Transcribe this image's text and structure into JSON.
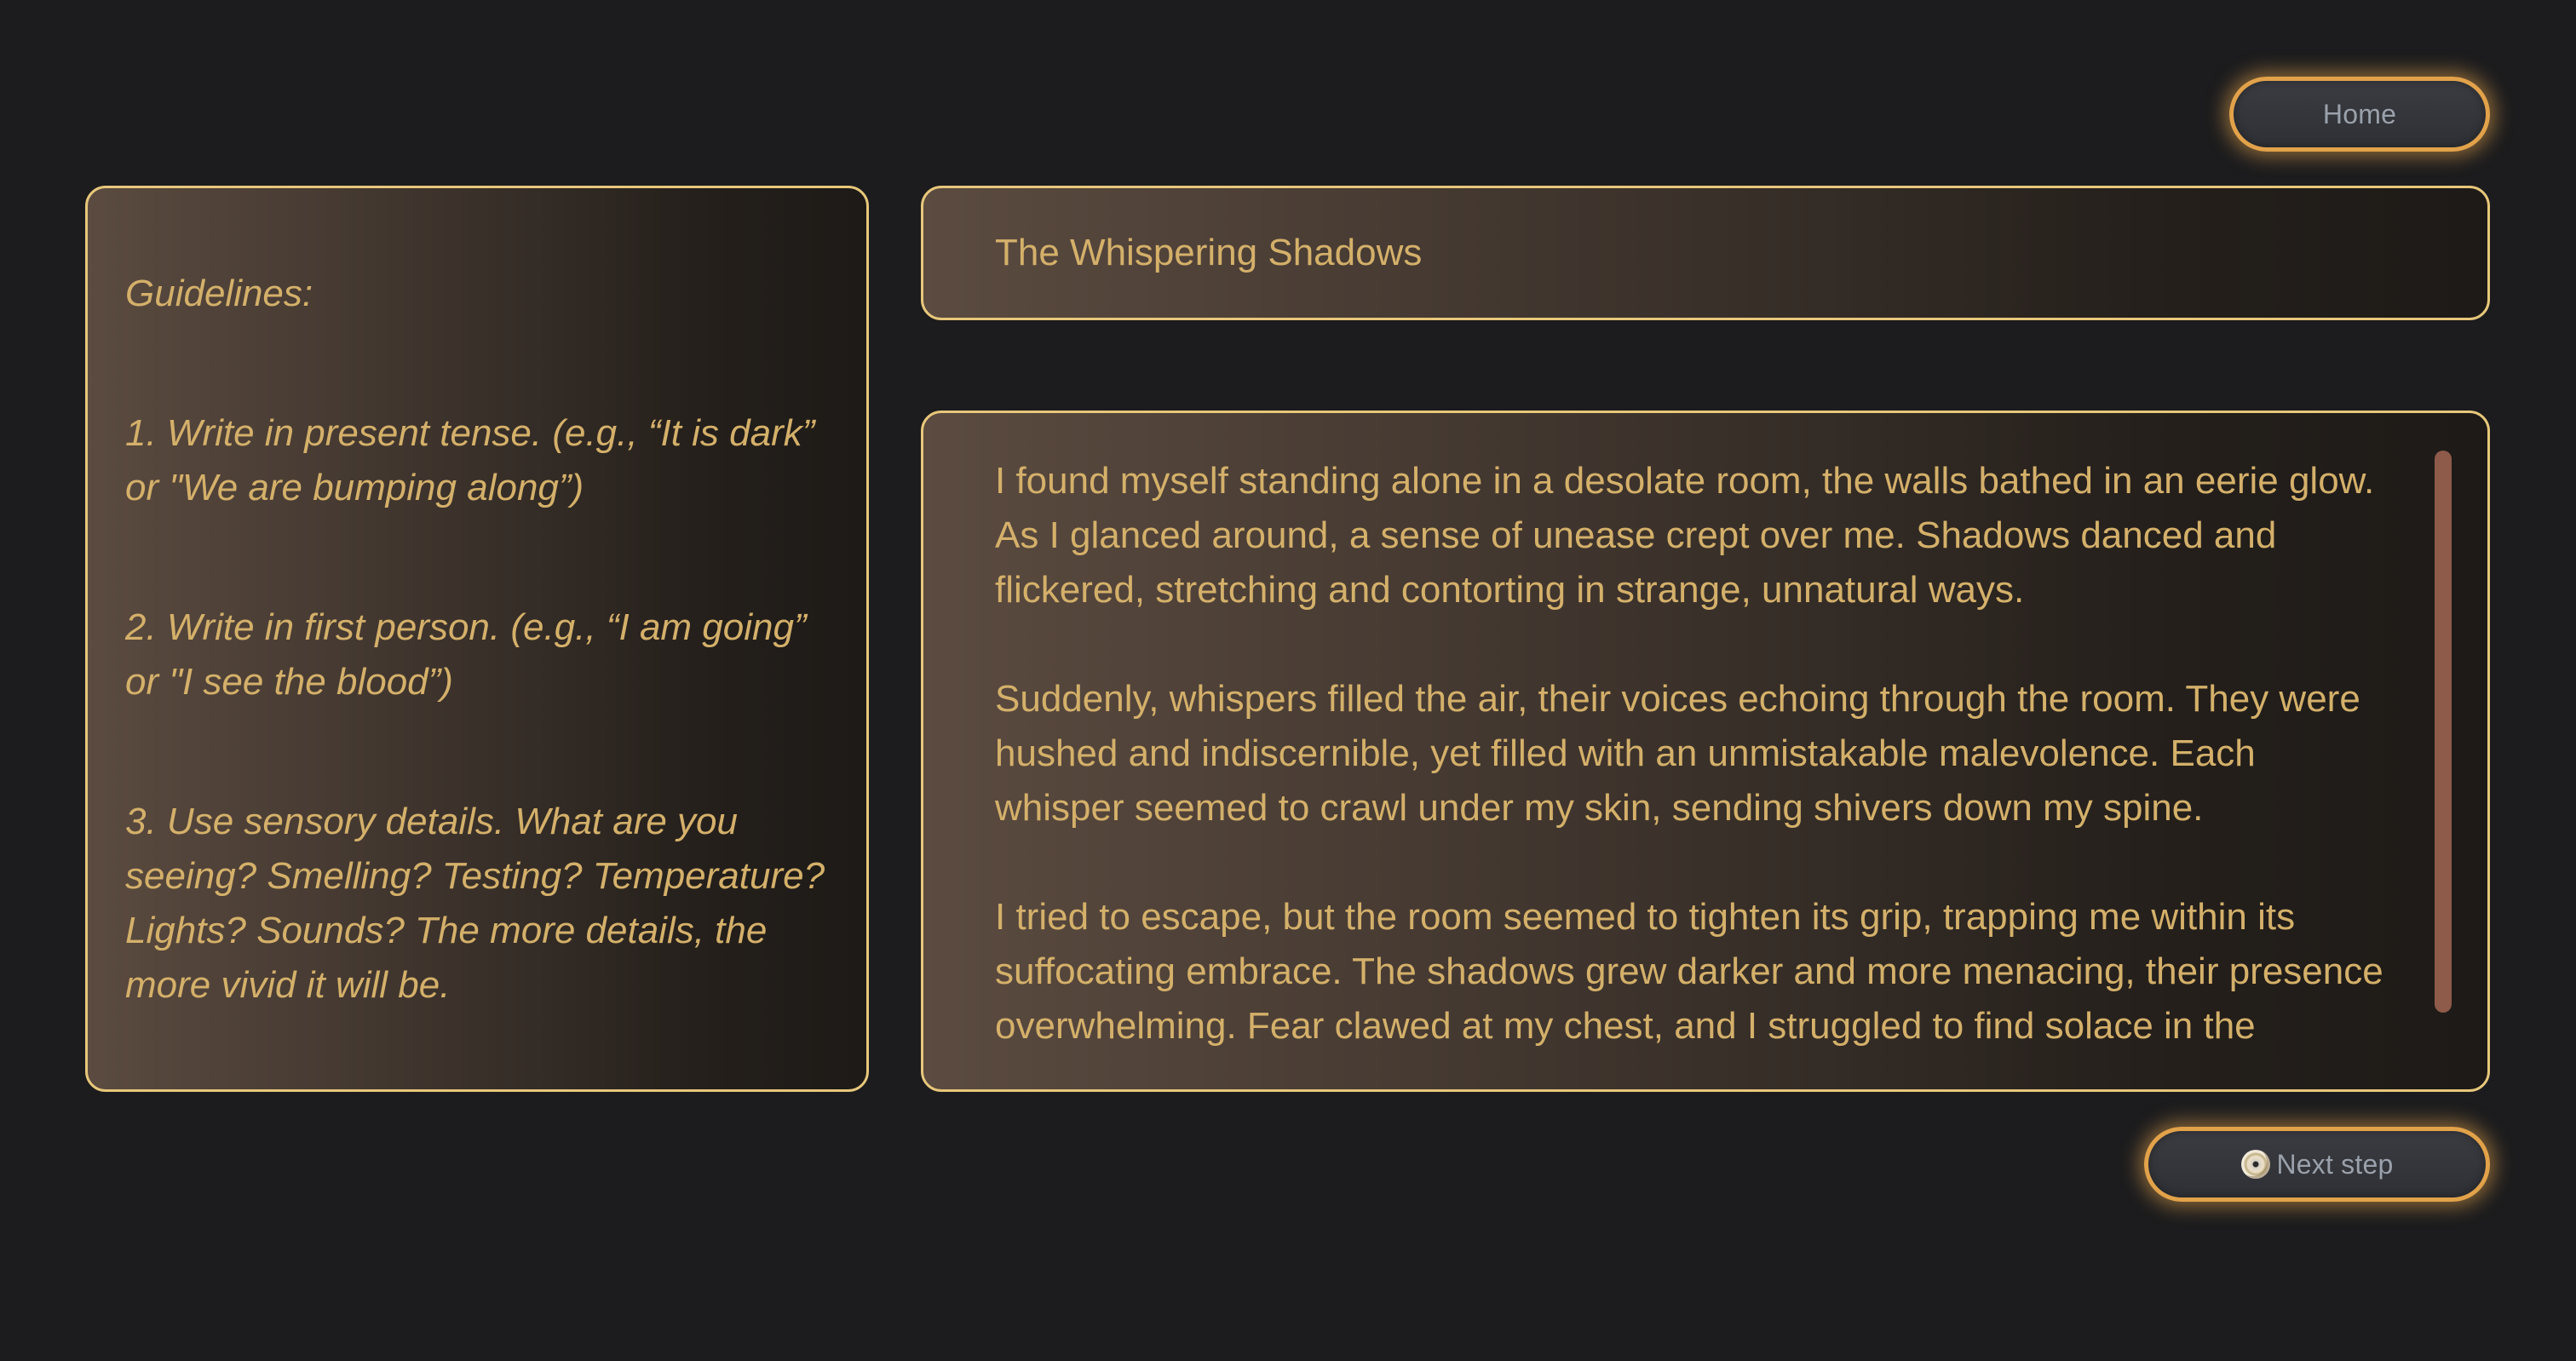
{
  "header": {
    "home_label": "Home"
  },
  "guidelines": {
    "heading": "Guidelines:",
    "items": [
      "1. Write in present tense. (e.g., “It is dark” or \"We are bumping along”)",
      "2. Write in first person. (e.g., “I am going” or \"I see the blood”)",
      "3. Use sensory details. What are you seeing? Smelling? Testing? Temperature? Lights? Sounds? The more details, the more vivid it will be."
    ]
  },
  "story": {
    "title": "The Whispering Shadows",
    "paragraphs": [
      "I found myself standing alone in a desolate room, the walls bathed in an eerie glow. As I glanced around, a sense of unease crept over me. Shadows danced and flickered, stretching and contorting in strange, unnatural ways.",
      "Suddenly, whispers filled the air, their voices echoing through the room. They were hushed and indiscernible, yet filled with an unmistakable malevolence. Each whisper seemed to crawl under my skin, sending shivers down my spine.",
      "I tried to escape, but the room seemed to tighten its grip, trapping me within its suffocating embrace. The shadows grew darker and more menacing, their presence overwhelming. Fear clawed at my chest, and I struggled to find solace in the"
    ]
  },
  "footer": {
    "next_label": "Next step",
    "next_icon": "cd-icon"
  },
  "colors": {
    "background": "#1c1c1e",
    "accent_border": "#e7c77a",
    "button_glow": "#e2a24a",
    "text": "#d4b06a",
    "button_text": "#9aa1ab",
    "scrollbar": "#8e5a4a"
  }
}
